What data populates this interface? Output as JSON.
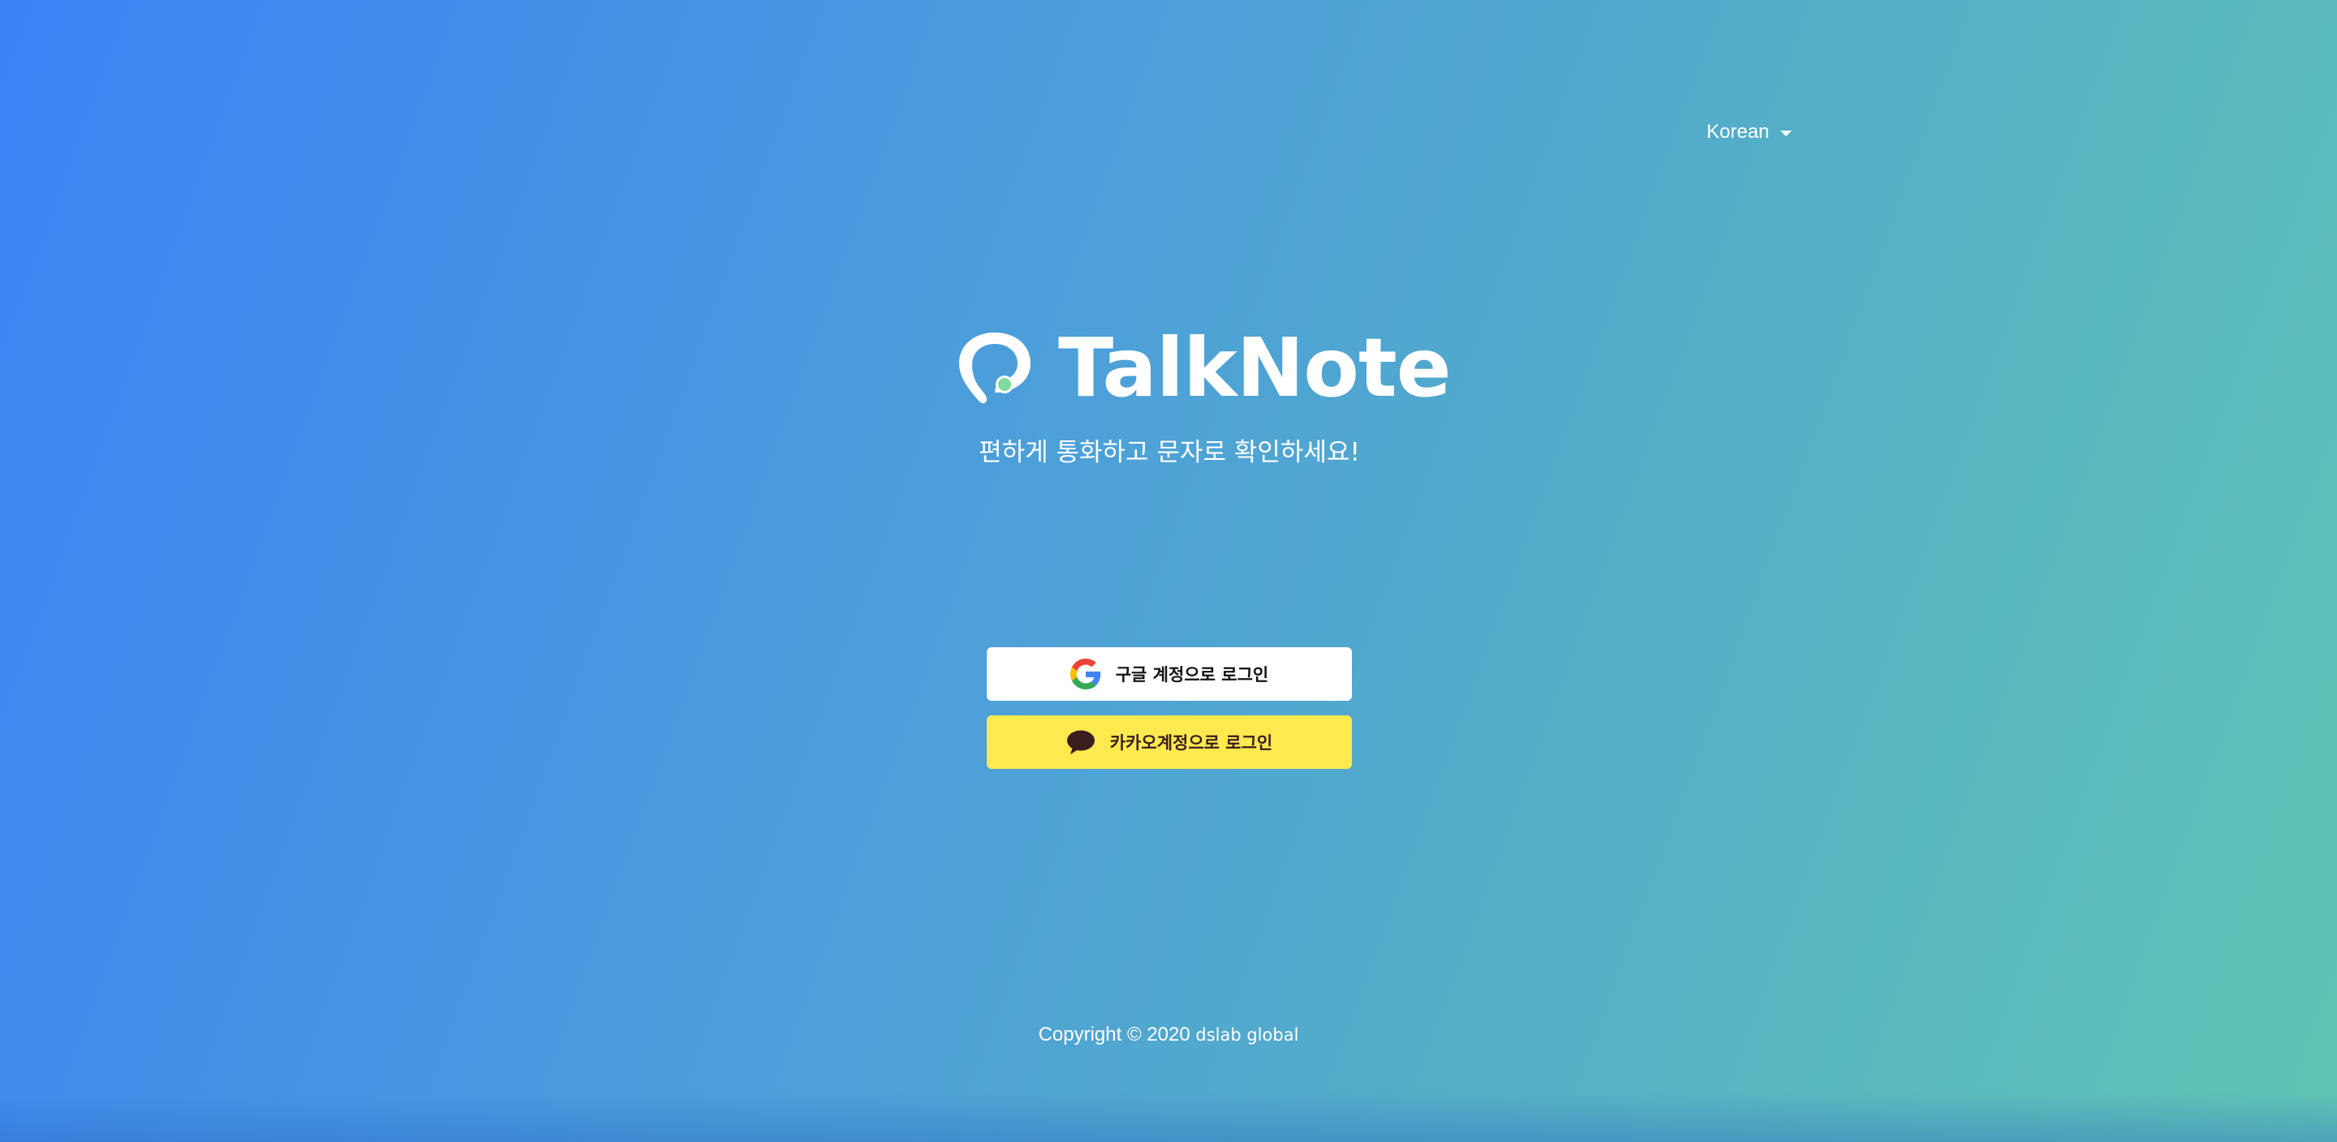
{
  "language_selector": {
    "label": "Korean"
  },
  "brand": {
    "name": "TalkNote",
    "tagline": "편하게 통화하고 문자로 확인하세요!"
  },
  "login": {
    "google_label": "구글 계정으로 로그인",
    "kakao_label": "카카오계정으로 로그인"
  },
  "footer": {
    "copyright": "Copyright © 2020",
    "company": "dslab global"
  },
  "colors": {
    "gradient_start": "#3b82f6",
    "gradient_end": "#5fc5b4",
    "kakao_yellow": "#fee94f",
    "logo_dot": "#7fdc9c"
  },
  "icons": {
    "google": "google-g-icon",
    "kakao": "speech-bubble-icon",
    "caret": "caret-down-icon"
  }
}
